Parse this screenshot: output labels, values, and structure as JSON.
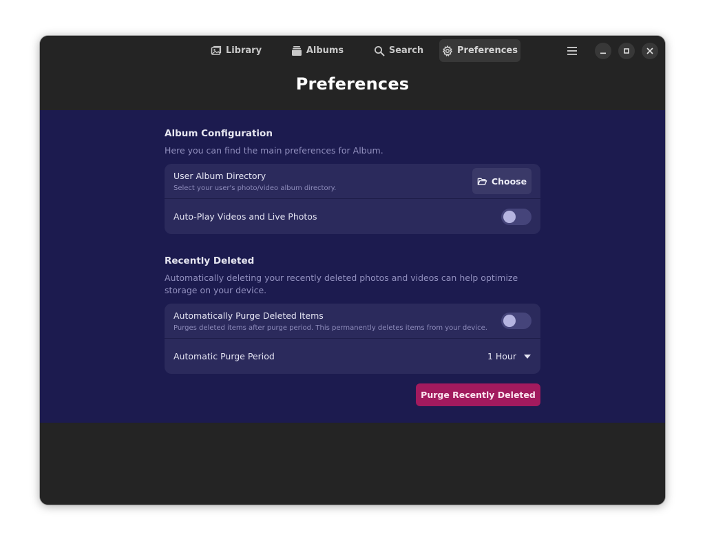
{
  "tabs": [
    {
      "label": "Library",
      "icon": "image-icon"
    },
    {
      "label": "Albums",
      "icon": "albums-icon"
    },
    {
      "label": "Search",
      "icon": "search-icon"
    },
    {
      "label": "Preferences",
      "icon": "gear-icon"
    }
  ],
  "active_tab": "Preferences",
  "page_title": "Preferences",
  "album_config": {
    "title": "Album Configuration",
    "description": "Here you can find the main preferences for Album.",
    "directory_title": "User Album Directory",
    "directory_subtitle": "Select your user's photo/video album directory.",
    "choose_label": "Choose",
    "autoplay_title": "Auto-Play Videos and Live Photos",
    "autoplay_on": false
  },
  "recently_deleted": {
    "title": "Recently Deleted",
    "description": "Automatically deleting your recently deleted photos and videos can help optimize storage on your device.",
    "auto_purge_title": "Automatically Purge Deleted Items",
    "auto_purge_subtitle": "Purges deleted items after purge period. This permanently deletes items from your device.",
    "auto_purge_on": false,
    "purge_period_title": "Automatic Purge Period",
    "purge_period_value": "1 Hour",
    "purge_button_label": "Purge Recently Deleted"
  },
  "colors": {
    "headerbar": "#242424",
    "content_bg": "#1c1b4f",
    "card_bg": "#2b2a5c",
    "destructive": "#a21a5e"
  }
}
